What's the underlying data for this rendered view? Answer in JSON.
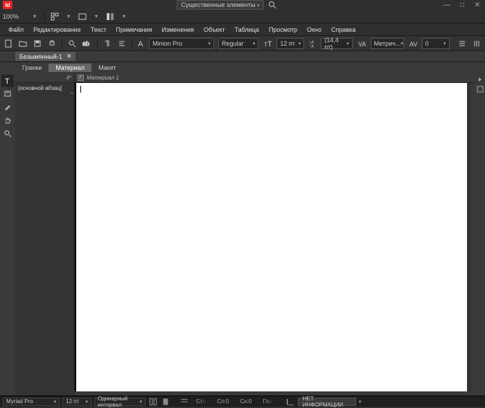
{
  "app": {
    "badge": "Id"
  },
  "titlebar": {
    "workspace": "Существенные элементы",
    "min": "—",
    "max": "□",
    "close": "✕"
  },
  "zoom": {
    "value": "100%"
  },
  "menu": [
    "Файл",
    "Редактирование",
    "Текст",
    "Примечания",
    "Изменения",
    "Объект",
    "Таблица",
    "Просмотр",
    "Окно",
    "Справка"
  ],
  "options": {
    "font": "Minion Pro",
    "style": "Regular",
    "size": "12 пт",
    "leading": "(14,4 пт)",
    "kerning": "Метрич...",
    "tracking": "0"
  },
  "document": {
    "tab": "Безымянный-1",
    "close": "✕"
  },
  "subtabs": [
    "Гранки",
    "Материал",
    "Макет"
  ],
  "subtabs_active": 1,
  "panel": {
    "head_marker": "4*",
    "item": "[основной абзац]",
    "marker": "¬"
  },
  "story": {
    "name": "Материал 1"
  },
  "status": {
    "font": "Myriad Pro",
    "size": "12 пт",
    "leading": "Одинарный интервал",
    "a1": "Ст:-",
    "a2": "Сл:0",
    "a3": "Сн:0",
    "a4": "Гл:-",
    "info": "НЕТ ИНФОРМАЦИИ"
  }
}
